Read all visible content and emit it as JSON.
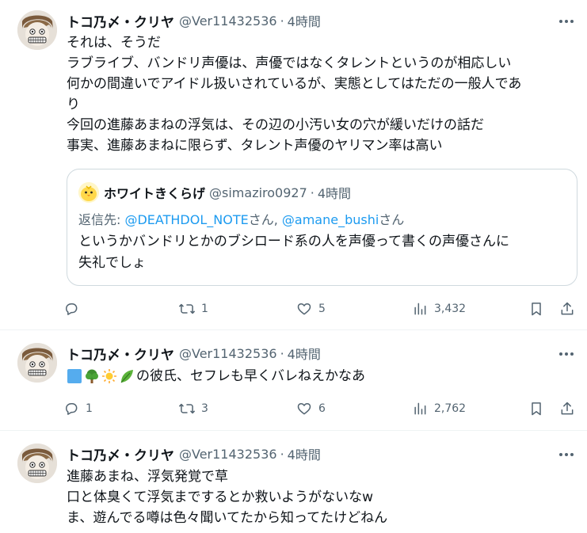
{
  "tweets": [
    {
      "author_name": "トコ乃〆・クリヤ",
      "handle": "@Ver11432536",
      "separator": "·",
      "time": "4時間",
      "lines": [
        "それは、そうだ",
        "ラブライブ、バンドリ声優は、声優ではなくタレントというのが相応しい",
        "何かの間違いでアイドル扱いされているが、実態としてはただの一般人であ",
        "り",
        "今回の進藤あまねの浮気は、その辺の小汚い女の穴が緩いだけの話だ",
        "事実、進藤あまねに限らず、タレント声優のヤリマン率は高い"
      ],
      "quote": {
        "author_name": "ホワイトきくらげ",
        "handle": "@simaziro0927",
        "separator": "·",
        "time": "4時間",
        "reply_prefix": "返信先: ",
        "reply_user1": "@DEATHDOL_NOTE",
        "reply_mid": "さん, ",
        "reply_user2": "@amane_bushi",
        "reply_suffix": "さん",
        "lines": [
          "というかバンドリとかのブシロード系の人を声優って書くの声優さんに",
          "失礼でしょ"
        ]
      },
      "stats": {
        "replies": "",
        "retweets": "1",
        "likes": "5",
        "views": "3,432"
      }
    },
    {
      "author_name": "トコ乃〆・クリヤ",
      "handle": "@Ver11432536",
      "separator": "·",
      "time": "4時間",
      "emoji_text": "の彼氏、セフレも早くバレねえかなあ",
      "emoji_icons": [
        "blue-square-emoji",
        "tree-emoji",
        "sun-emoji",
        "leafy-green-emoji"
      ],
      "stats": {
        "replies": "1",
        "retweets": "3",
        "likes": "6",
        "views": "2,762"
      }
    },
    {
      "author_name": "トコ乃〆・クリヤ",
      "handle": "@Ver11432536",
      "separator": "·",
      "time": "4時間",
      "lines": [
        "進藤あまね、浮気発覚で草",
        "口と体臭くて浮気までするとか救いようがないなw",
        "ま、遊んでる噂は色々聞いてたから知ってたけどねん"
      ]
    }
  ],
  "colors": {
    "text": "#0f1419",
    "secondary": "#536471",
    "link": "#1d9bf0",
    "border": "#cfd9de",
    "divider": "#eff3f4"
  }
}
